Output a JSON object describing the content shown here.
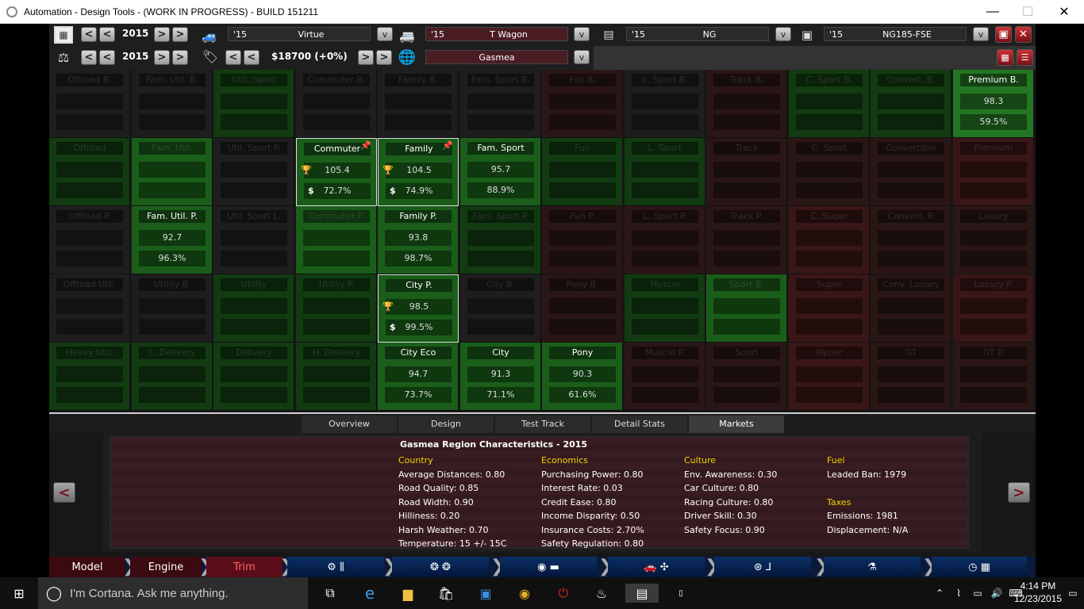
{
  "window": {
    "title": "Automation - Design Tools - (WORK IN PROGRESS) - BUILD 151211",
    "min": "—",
    "max": "☐",
    "close": "✕"
  },
  "toolbar": {
    "year1": "2015",
    "year2": "2015",
    "price": "$18700 (+0%)",
    "model": {
      "year": "'15",
      "name": "Virtue"
    },
    "trim": {
      "year": "'15",
      "name": "T Wagon"
    },
    "engine": {
      "year": "'15",
      "name": "NG"
    },
    "variant": {
      "year": "'15",
      "name": "NG185-FSE"
    },
    "region": "Gasmea",
    "left_btn": "<",
    "right_btn": ">",
    "dropdown": "v"
  },
  "grid": {
    "rows": [
      [
        {
          "label": "Offroad B.",
          "score": "",
          "pct": "",
          "style": "inactive",
          "dim": true
        },
        {
          "label": "Fam. Util. B.",
          "score": "",
          "pct": "",
          "style": "inactive",
          "dim": true
        },
        {
          "label": "Util. Sport",
          "score": "",
          "pct": "",
          "style": "g1",
          "dim": true
        },
        {
          "label": "Commuter B.",
          "score": "",
          "pct": "",
          "style": "inactive",
          "dim": true
        },
        {
          "label": "Family B.",
          "score": "",
          "pct": "",
          "style": "inactive",
          "dim": true
        },
        {
          "label": "Fam. Sport B.",
          "score": "",
          "pct": "",
          "style": "inactive",
          "dim": true
        },
        {
          "label": "Fun B.",
          "score": "",
          "pct": "",
          "style": "r1",
          "dim": true
        },
        {
          "label": "L. Sport B.",
          "score": "",
          "pct": "",
          "style": "inactive",
          "dim": true
        },
        {
          "label": "Track B.",
          "score": "",
          "pct": "",
          "style": "r1",
          "dim": true
        },
        {
          "label": "C. Sport B.",
          "score": "",
          "pct": "",
          "style": "g1",
          "dim": true
        },
        {
          "label": "Convert. B.",
          "score": "",
          "pct": "",
          "style": "g1",
          "dim": true
        },
        {
          "label": "Premium B.",
          "score": "98.3",
          "pct": "59.5%",
          "style": "g3",
          "dim": false
        }
      ],
      [
        {
          "label": "Offroad",
          "score": "",
          "pct": "",
          "style": "g1",
          "dim": true
        },
        {
          "label": "Fam. Util.",
          "score": "",
          "pct": "",
          "style": "g2",
          "dim": true
        },
        {
          "label": "Util. Sport P.",
          "score": "",
          "pct": "",
          "style": "inactive",
          "dim": true
        },
        {
          "label": "Commuter",
          "score": "105.4",
          "pct": "72.7%",
          "style": "g2",
          "dim": false,
          "hl": true,
          "pin": true,
          "trophy": true
        },
        {
          "label": "Family",
          "score": "104.5",
          "pct": "74.9%",
          "style": "g2",
          "dim": false,
          "hl": true,
          "pin": true,
          "trophy": true
        },
        {
          "label": "Fam. Sport",
          "score": "95.7",
          "pct": "88.9%",
          "style": "g2",
          "dim": false
        },
        {
          "label": "Fun",
          "score": "",
          "pct": "",
          "style": "g1",
          "dim": true
        },
        {
          "label": "L. Sport",
          "score": "",
          "pct": "",
          "style": "g1",
          "dim": true
        },
        {
          "label": "Track",
          "score": "",
          "pct": "",
          "style": "r1",
          "dim": true
        },
        {
          "label": "C. Sport",
          "score": "",
          "pct": "",
          "style": "r1",
          "dim": true
        },
        {
          "label": "Convertible",
          "score": "",
          "pct": "",
          "style": "r1",
          "dim": true
        },
        {
          "label": "Premium",
          "score": "",
          "pct": "",
          "style": "r2",
          "dim": true
        }
      ],
      [
        {
          "label": "Offroad P.",
          "score": "",
          "pct": "",
          "style": "inactive",
          "dim": true
        },
        {
          "label": "Fam. Util. P.",
          "score": "92.7",
          "pct": "96.3%",
          "style": "g2",
          "dim": false
        },
        {
          "label": "Util. Sport L.",
          "score": "",
          "pct": "",
          "style": "inactive",
          "dim": true
        },
        {
          "label": "Commuter P.",
          "score": "",
          "pct": "",
          "style": "g2",
          "dim": true
        },
        {
          "label": "Family P.",
          "score": "93.8",
          "pct": "98.7%",
          "style": "g2",
          "dim": false
        },
        {
          "label": "Fam. Sport P.",
          "score": "",
          "pct": "",
          "style": "g1",
          "dim": true
        },
        {
          "label": "Fun P.",
          "score": "",
          "pct": "",
          "style": "r1",
          "dim": true
        },
        {
          "label": "L. Sport P.",
          "score": "",
          "pct": "",
          "style": "r1",
          "dim": true
        },
        {
          "label": "Track P.",
          "score": "",
          "pct": "",
          "style": "r1",
          "dim": true
        },
        {
          "label": "C. Super",
          "score": "",
          "pct": "",
          "style": "r2",
          "dim": true
        },
        {
          "label": "Convert. P.",
          "score": "",
          "pct": "",
          "style": "r1",
          "dim": true
        },
        {
          "label": "Luxury",
          "score": "",
          "pct": "",
          "style": "r1",
          "dim": true
        }
      ],
      [
        {
          "label": "Offroad Util.",
          "score": "",
          "pct": "",
          "style": "inactive",
          "dim": true
        },
        {
          "label": "Utility B.",
          "score": "",
          "pct": "",
          "style": "inactive",
          "dim": true
        },
        {
          "label": "Utility",
          "score": "",
          "pct": "",
          "style": "g1",
          "dim": true
        },
        {
          "label": "Utility P.",
          "score": "",
          "pct": "",
          "style": "g1",
          "dim": true
        },
        {
          "label": "City P.",
          "score": "98.5",
          "pct": "99.5%",
          "style": "g2",
          "dim": false,
          "hl": true,
          "trophy": true
        },
        {
          "label": "City B.",
          "score": "",
          "pct": "",
          "style": "inactive",
          "dim": true
        },
        {
          "label": "Pony B.",
          "score": "",
          "pct": "",
          "style": "r1",
          "dim": true
        },
        {
          "label": "Muscle",
          "score": "",
          "pct": "",
          "style": "g1",
          "dim": true
        },
        {
          "label": "Sport B.",
          "score": "",
          "pct": "",
          "style": "g2",
          "dim": true
        },
        {
          "label": "Super",
          "score": "",
          "pct": "",
          "style": "r2",
          "dim": true
        },
        {
          "label": "Conv. Luxury",
          "score": "",
          "pct": "",
          "style": "r1",
          "dim": true
        },
        {
          "label": "Luxury P.",
          "score": "",
          "pct": "",
          "style": "r2",
          "dim": true
        }
      ],
      [
        {
          "label": "Heavy Util.",
          "score": "",
          "pct": "",
          "style": "g1",
          "dim": true
        },
        {
          "label": "L. Delivery",
          "score": "",
          "pct": "",
          "style": "g1",
          "dim": true
        },
        {
          "label": "Delivery",
          "score": "",
          "pct": "",
          "style": "g1",
          "dim": true
        },
        {
          "label": "H. Delivery",
          "score": "",
          "pct": "",
          "style": "g1",
          "dim": true
        },
        {
          "label": "City Eco",
          "score": "94.7",
          "pct": "73.7%",
          "style": "g2",
          "dim": false
        },
        {
          "label": "City",
          "score": "91.3",
          "pct": "71.1%",
          "style": "g2",
          "dim": false
        },
        {
          "label": "Pony",
          "score": "90.3",
          "pct": "61.6%",
          "style": "g2",
          "dim": false
        },
        {
          "label": "Muscle P.",
          "score": "",
          "pct": "",
          "style": "r1",
          "dim": true
        },
        {
          "label": "Sport",
          "score": "",
          "pct": "",
          "style": "r1",
          "dim": true
        },
        {
          "label": "Hyper",
          "score": "",
          "pct": "",
          "style": "r2",
          "dim": true
        },
        {
          "label": "GT",
          "score": "",
          "pct": "",
          "style": "r1",
          "dim": true
        },
        {
          "label": "GT P.",
          "score": "",
          "pct": "",
          "style": "r1",
          "dim": true
        }
      ]
    ]
  },
  "tabs": [
    "Overview",
    "Design",
    "Test Track",
    "Detail Stats",
    "Markets"
  ],
  "active_tab": 4,
  "region_info": {
    "header": "Gasmea Region Characteristics - 2015",
    "country": {
      "title": "Country",
      "lines": [
        "Average Distances:  0.80",
        "Road Quality:  0.85",
        "Road Width:  0.90",
        "Hilliness:  0.20",
        "Harsh Weather:  0.70",
        "Temperature:  15 +/- 15C"
      ]
    },
    "economics": {
      "title": "Economics",
      "lines": [
        "Purchasing Power:  0.80",
        "Interest Rate:  0.03",
        "Credit Ease:  0.80",
        "Income Disparity:  0.50",
        "Insurance Costs:  2.70%",
        "Safety Regulation:  0.80"
      ]
    },
    "culture": {
      "title": "Culture",
      "lines": [
        "Env. Awareness:  0.30",
        "Car Culture:  0.80",
        "Racing Culture:  0.80",
        "Driver Skill:  0.30",
        "Safety Focus:  0.90"
      ]
    },
    "fuel": {
      "title": "Fuel",
      "lines": [
        "Leaded Ban:  1979"
      ]
    },
    "taxes": {
      "title": "Taxes",
      "lines": [
        "Emissions:  1981",
        "Displacement: N/A"
      ]
    }
  },
  "bottom_nav": [
    "Model",
    "Engine",
    "Trim"
  ],
  "taskbar": {
    "search": "I'm Cortana. Ask me anything.",
    "time": "4:14 PM",
    "date": "12/23/2015"
  }
}
